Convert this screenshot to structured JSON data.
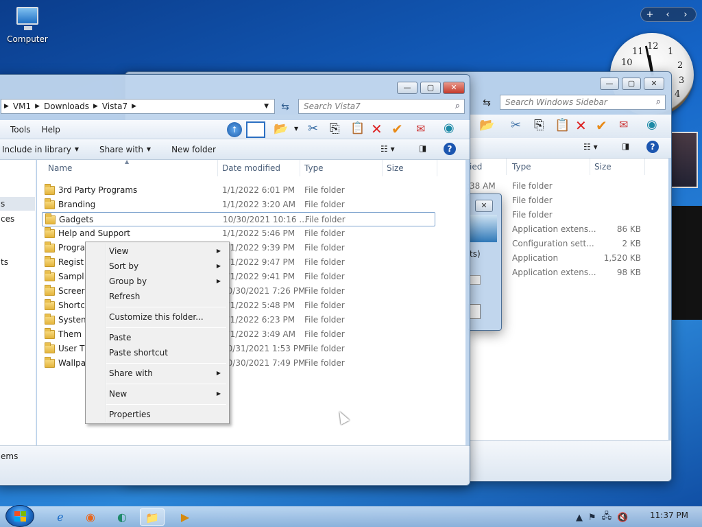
{
  "desktop": {
    "icon_label": "Computer"
  },
  "gadgets": {
    "controls": [
      "+",
      "‹",
      "›"
    ],
    "clock_numbers": [
      "12",
      "1",
      "2",
      "3",
      "4",
      "10",
      "11"
    ]
  },
  "back_window": {
    "search_placeholder": "Search Windows Sidebar",
    "columns": [
      "ied",
      "Type",
      "Size"
    ],
    "rows": [
      {
        "date": ":38 AM",
        "type": "File folder",
        "size": ""
      },
      {
        "date": "",
        "type": "File folder",
        "size": ""
      },
      {
        "date": "",
        "type": "File folder",
        "size": ""
      },
      {
        "date": "",
        "type": "Application extens...",
        "size": "86 KB"
      },
      {
        "date": "",
        "type": "Configuration sett...",
        "size": "2 KB"
      },
      {
        "date": "",
        "type": "Application",
        "size": "1,520 KB"
      },
      {
        "date": "",
        "type": "Application extens...",
        "size": "98 KB"
      }
    ],
    "dialog_fragment": "ts)"
  },
  "front_window": {
    "breadcrumbs": [
      "VM1",
      "Downloads",
      "Vista7"
    ],
    "search_placeholder": "Search Vista7",
    "menu": [
      "Tools",
      "Help"
    ],
    "commands": {
      "library": "Include in library",
      "share": "Share with",
      "new_folder": "New folder"
    },
    "columns": {
      "name": "Name",
      "date": "Date modified",
      "type": "Type",
      "size": "Size"
    },
    "rows": [
      {
        "name": "3rd Party Programs",
        "date": "1/1/2022 6:01 PM",
        "type": "File folder"
      },
      {
        "name": "Branding",
        "date": "1/1/2022 3:20 AM",
        "type": "File folder"
      },
      {
        "name": "Gadgets",
        "date": "10/30/2021 10:16 ...",
        "type": "File folder"
      },
      {
        "name": "Help and Support",
        "date": "1/1/2022 5:46 PM",
        "type": "File folder"
      },
      {
        "name": "Progra",
        "date": "1/1/2022 9:39 PM",
        "type": "File folder"
      },
      {
        "name": "Regist",
        "date": "1/1/2022 9:47 PM",
        "type": "File folder"
      },
      {
        "name": "Sampl",
        "date": "1/1/2022 9:41 PM",
        "type": "File folder"
      },
      {
        "name": "Screer",
        "date": "10/30/2021 7:26 PM",
        "type": "File folder"
      },
      {
        "name": "Shortc",
        "date": "1/1/2022 5:48 PM",
        "type": "File folder"
      },
      {
        "name": "Systen",
        "date": "1/1/2022 6:23 PM",
        "type": "File folder"
      },
      {
        "name": "Them",
        "date": "1/1/2022 3:49 AM",
        "type": "File folder"
      },
      {
        "name": "User T",
        "date": "10/31/2021 1:53 PM",
        "type": "File folder"
      },
      {
        "name": "Wallpa",
        "date": "10/30/2021 7:49 PM",
        "type": "File folder"
      }
    ],
    "nav_fragments": [
      "s",
      "ces",
      "ts"
    ],
    "status": "ems"
  },
  "context_menu": {
    "view": "View",
    "sort_by": "Sort by",
    "group_by": "Group by",
    "refresh": "Refresh",
    "customize": "Customize this folder...",
    "paste": "Paste",
    "paste_shortcut": "Paste shortcut",
    "share_with": "Share with",
    "new": "New",
    "properties": "Properties"
  },
  "taskbar": {
    "time": "11:37 PM"
  }
}
